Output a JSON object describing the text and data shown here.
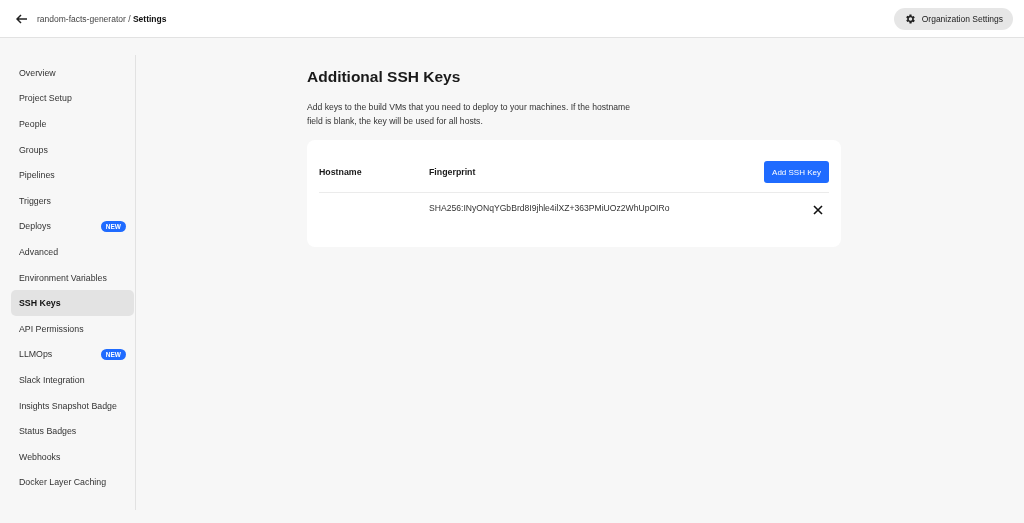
{
  "header": {
    "breadcrumb_project": "random-facts-generator",
    "breadcrumb_separator": "/",
    "breadcrumb_page": "Settings",
    "org_button": "Organization Settings"
  },
  "sidebar": {
    "items": [
      {
        "label": "Overview",
        "selected": false
      },
      {
        "label": "Project Setup",
        "selected": false
      },
      {
        "label": "People",
        "selected": false
      },
      {
        "label": "Groups",
        "selected": false
      },
      {
        "label": "Pipelines",
        "selected": false
      },
      {
        "label": "Triggers",
        "selected": false
      },
      {
        "label": "Deploys",
        "selected": false,
        "badge": "NEW"
      },
      {
        "label": "Advanced",
        "selected": false
      },
      {
        "label": "Environment Variables",
        "selected": false
      },
      {
        "label": "SSH Keys",
        "selected": true
      },
      {
        "label": "API Permissions",
        "selected": false
      },
      {
        "label": "LLMOps",
        "selected": false,
        "badge": "NEW"
      },
      {
        "label": "Slack Integration",
        "selected": false
      },
      {
        "label": "Insights Snapshot Badge",
        "selected": false
      },
      {
        "label": "Status Badges",
        "selected": false
      },
      {
        "label": "Webhooks",
        "selected": false
      },
      {
        "label": "Docker Layer Caching",
        "selected": false
      }
    ]
  },
  "content": {
    "title": "Additional SSH Keys",
    "description": "Add keys to the build VMs that you need to deploy to your machines. If the hostname field is blank, the key will be used for all hosts.",
    "table": {
      "columns": [
        "Hostname",
        "Fingerprint"
      ],
      "add_button": "Add SSH Key",
      "rows": [
        {
          "fingerprint": "SHA256:INyONqYGbBrd8I9jhle4ilXZ+363PMiUOz2WhUpOIRo"
        }
      ]
    }
  }
}
